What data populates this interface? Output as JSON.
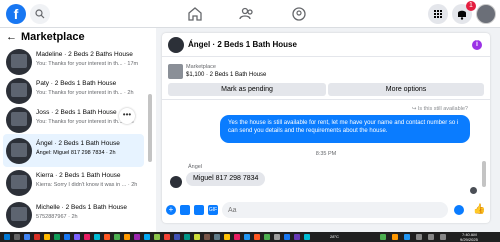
{
  "topnav": {
    "logo_letter": "f",
    "icons": [
      "search-icon",
      "home-icon",
      "friends-icon",
      "groups-icon",
      "menu-grid-icon",
      "notifications-icon",
      "profile-avatar"
    ],
    "notification_count": "1",
    "brand_color": "#1877f2"
  },
  "left": {
    "title": "Marketplace",
    "back_arrow": "←",
    "more_label": "•••",
    "conversations": [
      {
        "title": "Madeline · 2 Beds 2 Baths House",
        "sub": "You: Thanks for your interest in th... · 17m"
      },
      {
        "title": "Paty · 2 Beds 1 Bath House",
        "sub": "You: Thanks for your interest in th... · 2h"
      },
      {
        "title": "Joss · 2 Beds 1 Bath House",
        "sub": "You: Thanks for your interest in th... · 2h"
      },
      {
        "title": "Ángel · 2 Beds 1 Bath House",
        "sub": "Ángel: Miguel 817 298 7834 · 2h"
      },
      {
        "title": "Kierra · 2 Beds 1 Bath House",
        "sub": "Kierra: Sorry I didn't know it was in ... · 2h"
      },
      {
        "title": "Michelle · 2 Beds 1 Bath House",
        "sub": "5752887967 · 2h"
      }
    ]
  },
  "chat": {
    "header_name": "Ángel · 2 Beds 1 Bath House",
    "info_label": "i",
    "listing_label": "Marketplace",
    "listing_price": "$1,100 · 2 Beds 1 Bath House",
    "mark_pending_label": "Mark as pending",
    "more_options_label": "More options",
    "reply_context": "↪ Is this still available?",
    "outgoing_message": "Yes the house is still available for rent, let me have your name and  contact number so i can send you details and the requirements about the house.",
    "timestamp": "8:35 PM",
    "sender_name": "Ángel",
    "incoming_message": "Miguel 817 298 7834",
    "input_placeholder": "Aa",
    "accent_color": "#0a7cff"
  },
  "taskbar": {
    "weather": "28°C",
    "time": "7:40 AM",
    "date": "9/29/2025"
  }
}
